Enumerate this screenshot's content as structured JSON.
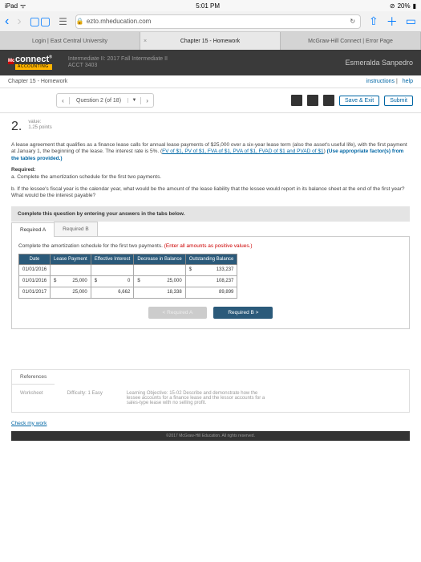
{
  "status": {
    "device": "iPad",
    "wifi": "ᯤ",
    "time": "5:01 PM",
    "battery_pct": "20%",
    "battery_icon": "🔋"
  },
  "safari": {
    "url": "ezto.mheducation.com"
  },
  "tabs": {
    "t0": "Login | East Central University",
    "t1": "Chapter 15 - Homework",
    "t2": "McGraw-Hill Connect | Error Page"
  },
  "connect": {
    "brand": "connect",
    "sub": "ACCOUNTING",
    "course_line1": "Intermediate II: 2017 Fall Intermediate II",
    "course_line2": "ACCT 3403",
    "student": "Esmeralda Sanpedro"
  },
  "crumb": {
    "path": "Chapter 15 - Homework",
    "instructions": "instructions",
    "help": "help"
  },
  "toolbar": {
    "q_label": "Question 2 (of 18)",
    "save": "Save & Exit",
    "submit": "Submit"
  },
  "question": {
    "num": "2.",
    "value_label": "value:",
    "points": "1.25 points",
    "para": "A lease agreement that qualifies as a finance lease calls for annual lease payments of $25,000 over a six-year lease term (also the asset's useful life), with the first payment at January 1, the beginning of the lease. The interest rate is 5%. (",
    "links": "FV of $1, PV of $1, FVA of $1, PVA of $1, FVAD of $1 and PVAD of $1",
    "after_links": ") ",
    "use_appropriate": "(Use appropriate factor(s) from the tables provided.)",
    "req_label": "Required:",
    "req_a": "a. Complete the amortization schedule for the first two payments.",
    "req_b": "b. If the lessee's fiscal year is the calendar year, what would be the amount of the lease liability that the lessee would report in its balance sheet at the end of the first year? What would be the interest payable?",
    "instruct": "Complete this question by entering your answers in the tabs below.",
    "tab_a": "Required A",
    "tab_b": "Required B",
    "tab_msg": "Complete the amortization schedule for the first two payments. ",
    "tab_msg_red": "(Enter all amounts as positive values.)"
  },
  "table": {
    "h_date": "Date",
    "h_pay": "Lease Payment",
    "h_int": "Effective Interest",
    "h_dec": "Decrease in Balance",
    "h_bal": "Outstanding Balance",
    "r0": {
      "date": "01/01/2016",
      "pay": "",
      "int": "",
      "dec": "",
      "bal": "133,237"
    },
    "r1": {
      "date": "01/01/2016",
      "pay": "25,000",
      "int": "0",
      "dec": "25,000",
      "bal": "108,237"
    },
    "r2": {
      "date": "01/01/2017",
      "pay": "25,000",
      "int": "6,662",
      "dec": "18,338",
      "bal": "89,899"
    }
  },
  "navbtn": {
    "prev": "< Required A",
    "next": "Required B  >"
  },
  "refs": {
    "tab": "References",
    "worksheet": "Worksheet",
    "difficulty": "Difficulty: 1 Easy",
    "lo": "Learning Objective: 15-02 Describe and demonstrate how the lessee accounts for a finance lease and the lessor accounts for a sales-type lease with no selling profit."
  },
  "check": "Check my work",
  "footer": "©2017 McGraw-Hill Education. All rights reserved."
}
